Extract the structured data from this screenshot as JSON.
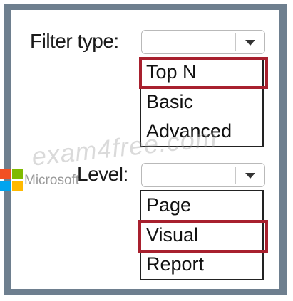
{
  "filter_type": {
    "label": "Filter type:",
    "selected_value": "",
    "options": [
      "Top N",
      "Basic",
      "Advanced"
    ],
    "highlighted_option": "Top N"
  },
  "level": {
    "label": "Level:",
    "selected_value": "",
    "options": [
      "Page",
      "Visual",
      "Report"
    ],
    "highlighted_option": "Visual"
  },
  "watermark": {
    "text": "exam4free.com",
    "brand_text": "Microsoft"
  },
  "colors": {
    "frame": "#6e7f8f",
    "highlight": "#a8202e",
    "logo_red": "#f25022",
    "logo_green": "#7fba00",
    "logo_blue": "#00a4ef",
    "logo_yellow": "#ffb900"
  }
}
